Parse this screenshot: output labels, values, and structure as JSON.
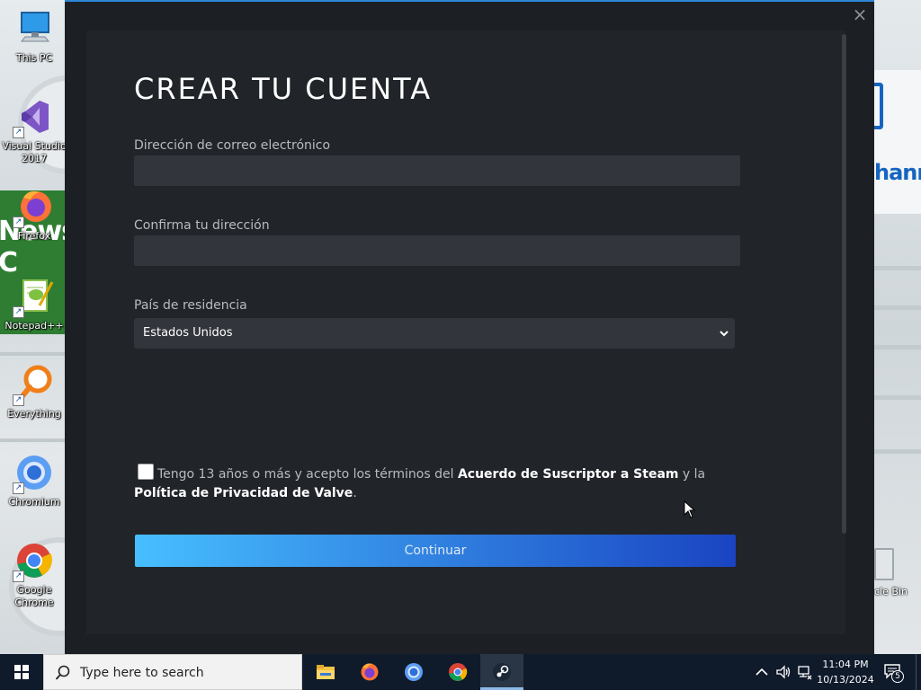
{
  "desktop": {
    "background_text_left": "News C",
    "background_text_right": "hanne",
    "icons": [
      {
        "label": "This PC"
      },
      {
        "label": "Visual Studio 2017"
      },
      {
        "label": "Firefox"
      },
      {
        "label": "Notepad++"
      },
      {
        "label": "Everything"
      },
      {
        "label": "Chromium"
      },
      {
        "label": "Google Chrome"
      }
    ],
    "recycle_bin_label": "cle Bin"
  },
  "dialog": {
    "close_symbol": "×",
    "title": "CREAR TU CUENTA",
    "email_label": "Dirección de correo electrónico",
    "email_value": "",
    "confirm_label": "Confirma tu dirección",
    "confirm_value": "",
    "country_label": "País de residencia",
    "country_value": "Estados Unidos",
    "terms": {
      "checked": false,
      "text_before": "Tengo 13 años o más y acepto los términos del ",
      "link_subscriber": "Acuerdo de Suscriptor a Steam",
      "text_middle": " y la ",
      "link_privacy": "Política de Privacidad de Valve",
      "text_after": "."
    },
    "continue_label": "Continuar",
    "accent_color": "#2d86d6",
    "button_gradient": [
      "#47bfff",
      "#1a44c2"
    ]
  },
  "taskbar": {
    "search_placeholder": "Type here to search",
    "apps": [
      {
        "name": "File Explorer",
        "icon": "folder-icon",
        "active": false
      },
      {
        "name": "Firefox",
        "icon": "firefox-icon",
        "active": false
      },
      {
        "name": "Chromium",
        "icon": "chromium-icon",
        "active": false
      },
      {
        "name": "Google Chrome",
        "icon": "chrome-icon",
        "active": false
      },
      {
        "name": "Steam",
        "icon": "steam-icon",
        "active": true
      }
    ],
    "clock_time": "11:04 PM",
    "clock_date": "10/13/2024",
    "notification_count": "5"
  }
}
